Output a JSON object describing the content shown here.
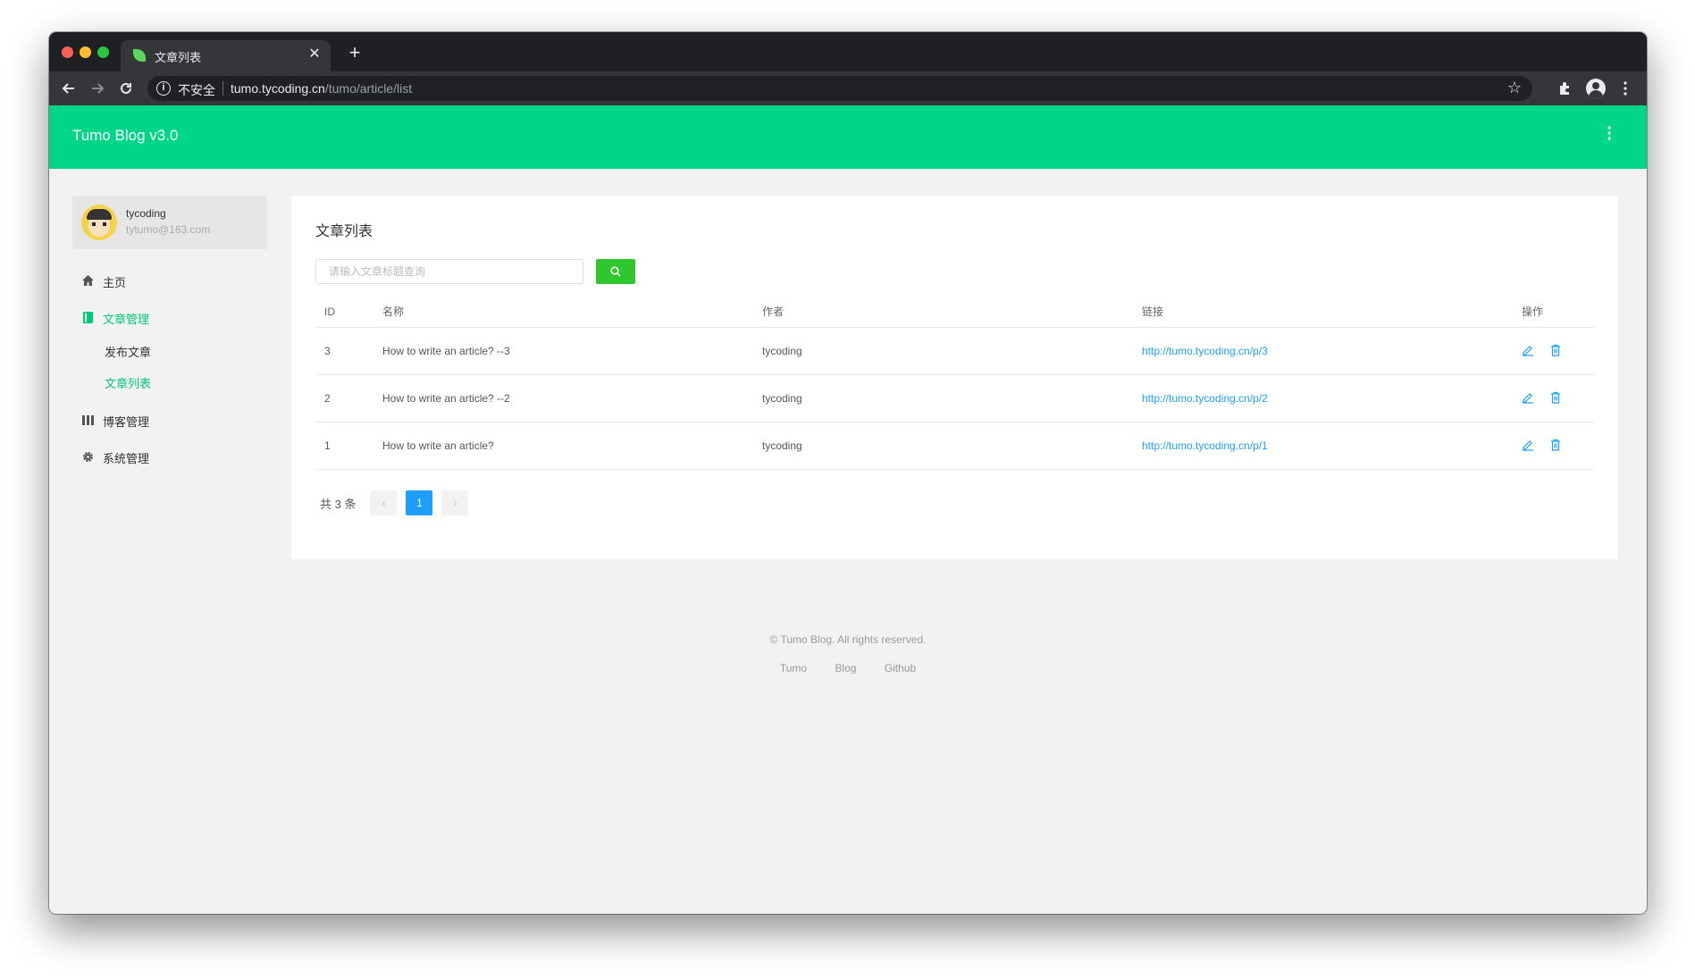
{
  "browser": {
    "tab_title": "文章列表",
    "close_glyph": "✕",
    "new_tab_glyph": "+",
    "insecure_label": "不安全",
    "url_host": "tumo.tycoding.cn",
    "url_path": "/tumo/article/list"
  },
  "app": {
    "title": "Tumo Blog v3.0",
    "accent_color": "#00d68a",
    "active_color": "#00c977"
  },
  "user": {
    "name": "tycoding",
    "email": "tytumo@163.com"
  },
  "sidebar": {
    "items": [
      {
        "label": "主页",
        "icon": "home-icon"
      },
      {
        "label": "文章管理",
        "icon": "book-icon",
        "children": [
          "发布文章",
          "文章列表"
        ]
      },
      {
        "label": "博客管理",
        "icon": "bars-icon"
      },
      {
        "label": "系统管理",
        "icon": "gear-icon"
      }
    ]
  },
  "main": {
    "title": "文章列表",
    "search_placeholder": "请输入文章标题查询",
    "columns": [
      "ID",
      "名称",
      "作者",
      "链接",
      "操作"
    ],
    "rows": [
      {
        "id": "3",
        "name": "How to write an article? --3",
        "author": "tycoding",
        "link": "http://tumo.tycoding.cn/p/3"
      },
      {
        "id": "2",
        "name": "How to write an article? --2",
        "author": "tycoding",
        "link": "http://tumo.tycoding.cn/p/2"
      },
      {
        "id": "1",
        "name": "How to write an article?",
        "author": "tycoding",
        "link": "http://tumo.tycoding.cn/p/1"
      }
    ],
    "pager": {
      "total": "共 3 条",
      "prev": "‹",
      "current": "1",
      "next": "›"
    }
  },
  "footer": {
    "copyright": "© Tumo Blog. All rights reserved.",
    "links": [
      "Tumo",
      "Blog",
      "Github"
    ]
  }
}
